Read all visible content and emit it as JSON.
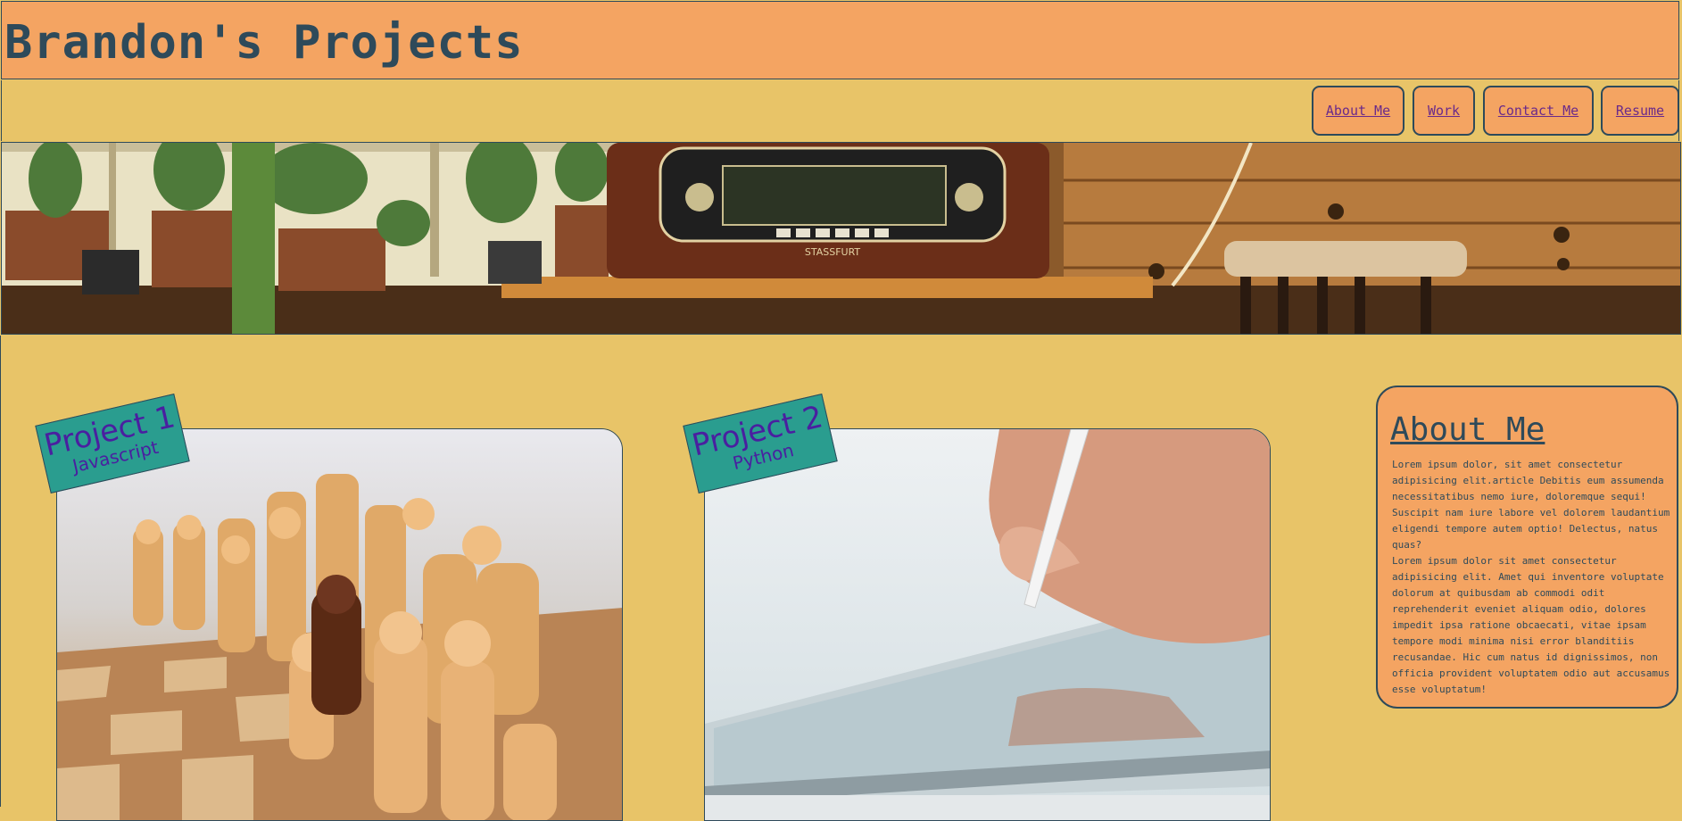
{
  "header": {
    "title": "Brandon's Projects"
  },
  "nav": {
    "items": [
      {
        "label": "About Me"
      },
      {
        "label": "Work"
      },
      {
        "label": "Contact Me"
      },
      {
        "label": "Resume"
      }
    ]
  },
  "banner": {
    "icon": "banner-image-radio-plants",
    "radio_label": "STASSFURT"
  },
  "projects": [
    {
      "title": "Project 1",
      "subtitle": "Javascript",
      "image": "chess-pieces-image"
    },
    {
      "title": "Project 2",
      "subtitle": "Python",
      "image": "tablet-stylus-image"
    }
  ],
  "about": {
    "heading": "About Me",
    "paragraph1": "Lorem ipsum dolor, sit amet consectetur adipisicing elit.article Debitis eum assumenda necessitatibus nemo iure, doloremque sequi! Suscipit nam iure labore vel dolorem laudantium eligendi tempore autem optio! Delectus, natus quas?",
    "paragraph2": "Lorem ipsum dolor sit amet consectetur adipisicing elit. Amet qui inventore voluptate dolorum at quibusdam ab commodi odit reprehenderit eveniet aliquam odio, dolores impedit ipsa ratione obcaecati, vitae ipsam tempore modi minima nisi error blanditiis recusandae. Hic cum natus id dignissimos, non officia provident voluptatem odio aut accusamus esse voluptatum!"
  },
  "colors": {
    "background": "#E8C468",
    "accent": "#F4A462",
    "tag": "#2A9D8F",
    "text": "#2E4A5A",
    "link": "#6A2A8A"
  }
}
